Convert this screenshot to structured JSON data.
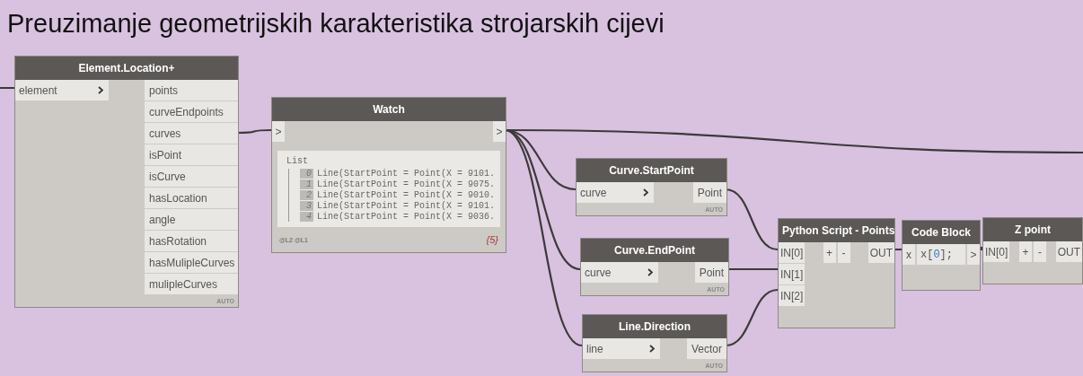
{
  "title": "Preuzimanje geometrijskih karakteristika strojarskih cijevi",
  "nodes": [
    {
      "kind": "function",
      "title": "Element.Location+",
      "inputs": [
        "element"
      ],
      "outputs": [
        "points",
        "curveEndpoints",
        "curves",
        "isPoint",
        "isCurve",
        "hasLocation",
        "angle",
        "hasRotation",
        "hasMulipleCurves",
        "mulipleCurves"
      ],
      "lacing": "AUTO"
    },
    {
      "kind": "watch",
      "title": "Watch",
      "inputs": [
        ">"
      ],
      "outputs": [
        ">"
      ],
      "list_label": "List",
      "items": [
        {
          "index": "0",
          "text": "Line(StartPoint = Point(X = 9101."
        },
        {
          "index": "1",
          "text": "Line(StartPoint = Point(X = 9075."
        },
        {
          "index": "2",
          "text": "Line(StartPoint = Point(X = 9010."
        },
        {
          "index": "3",
          "text": "Line(StartPoint = Point(X = 9101."
        },
        {
          "index": "4",
          "text": "Line(StartPoint = Point(X = 9036."
        }
      ],
      "levels": "@L2 @L1",
      "count": "{5}"
    },
    {
      "kind": "function",
      "title": "Curve.StartPoint",
      "inputs": [
        "curve"
      ],
      "outputs": [
        "Point"
      ],
      "lacing": "AUTO"
    },
    {
      "kind": "function",
      "title": "Curve.EndPoint",
      "inputs": [
        "curve"
      ],
      "outputs": [
        "Point"
      ],
      "lacing": "AUTO"
    },
    {
      "kind": "function",
      "title": "Line.Direction",
      "inputs": [
        "line"
      ],
      "outputs": [
        "Vector"
      ],
      "lacing": "AUTO"
    },
    {
      "kind": "python",
      "title": "Python Script - Points",
      "inputs": [
        "IN[0]",
        "IN[1]",
        "IN[2]"
      ],
      "add": "+",
      "remove": "-",
      "outputs": [
        "OUT"
      ]
    },
    {
      "kind": "code_block",
      "title": "Code Block",
      "inputs": [
        "x"
      ],
      "code": [
        {
          "kind": "plain",
          "text": "x["
        },
        {
          "kind": "number",
          "text": "0"
        },
        {
          "kind": "plain",
          "text": "];"
        }
      ],
      "outputs": [
        ">"
      ]
    },
    {
      "kind": "python",
      "title": "Z point",
      "inputs": [
        "IN[0]"
      ],
      "add": "+",
      "remove": "-",
      "outputs": [
        "OUT"
      ]
    }
  ]
}
